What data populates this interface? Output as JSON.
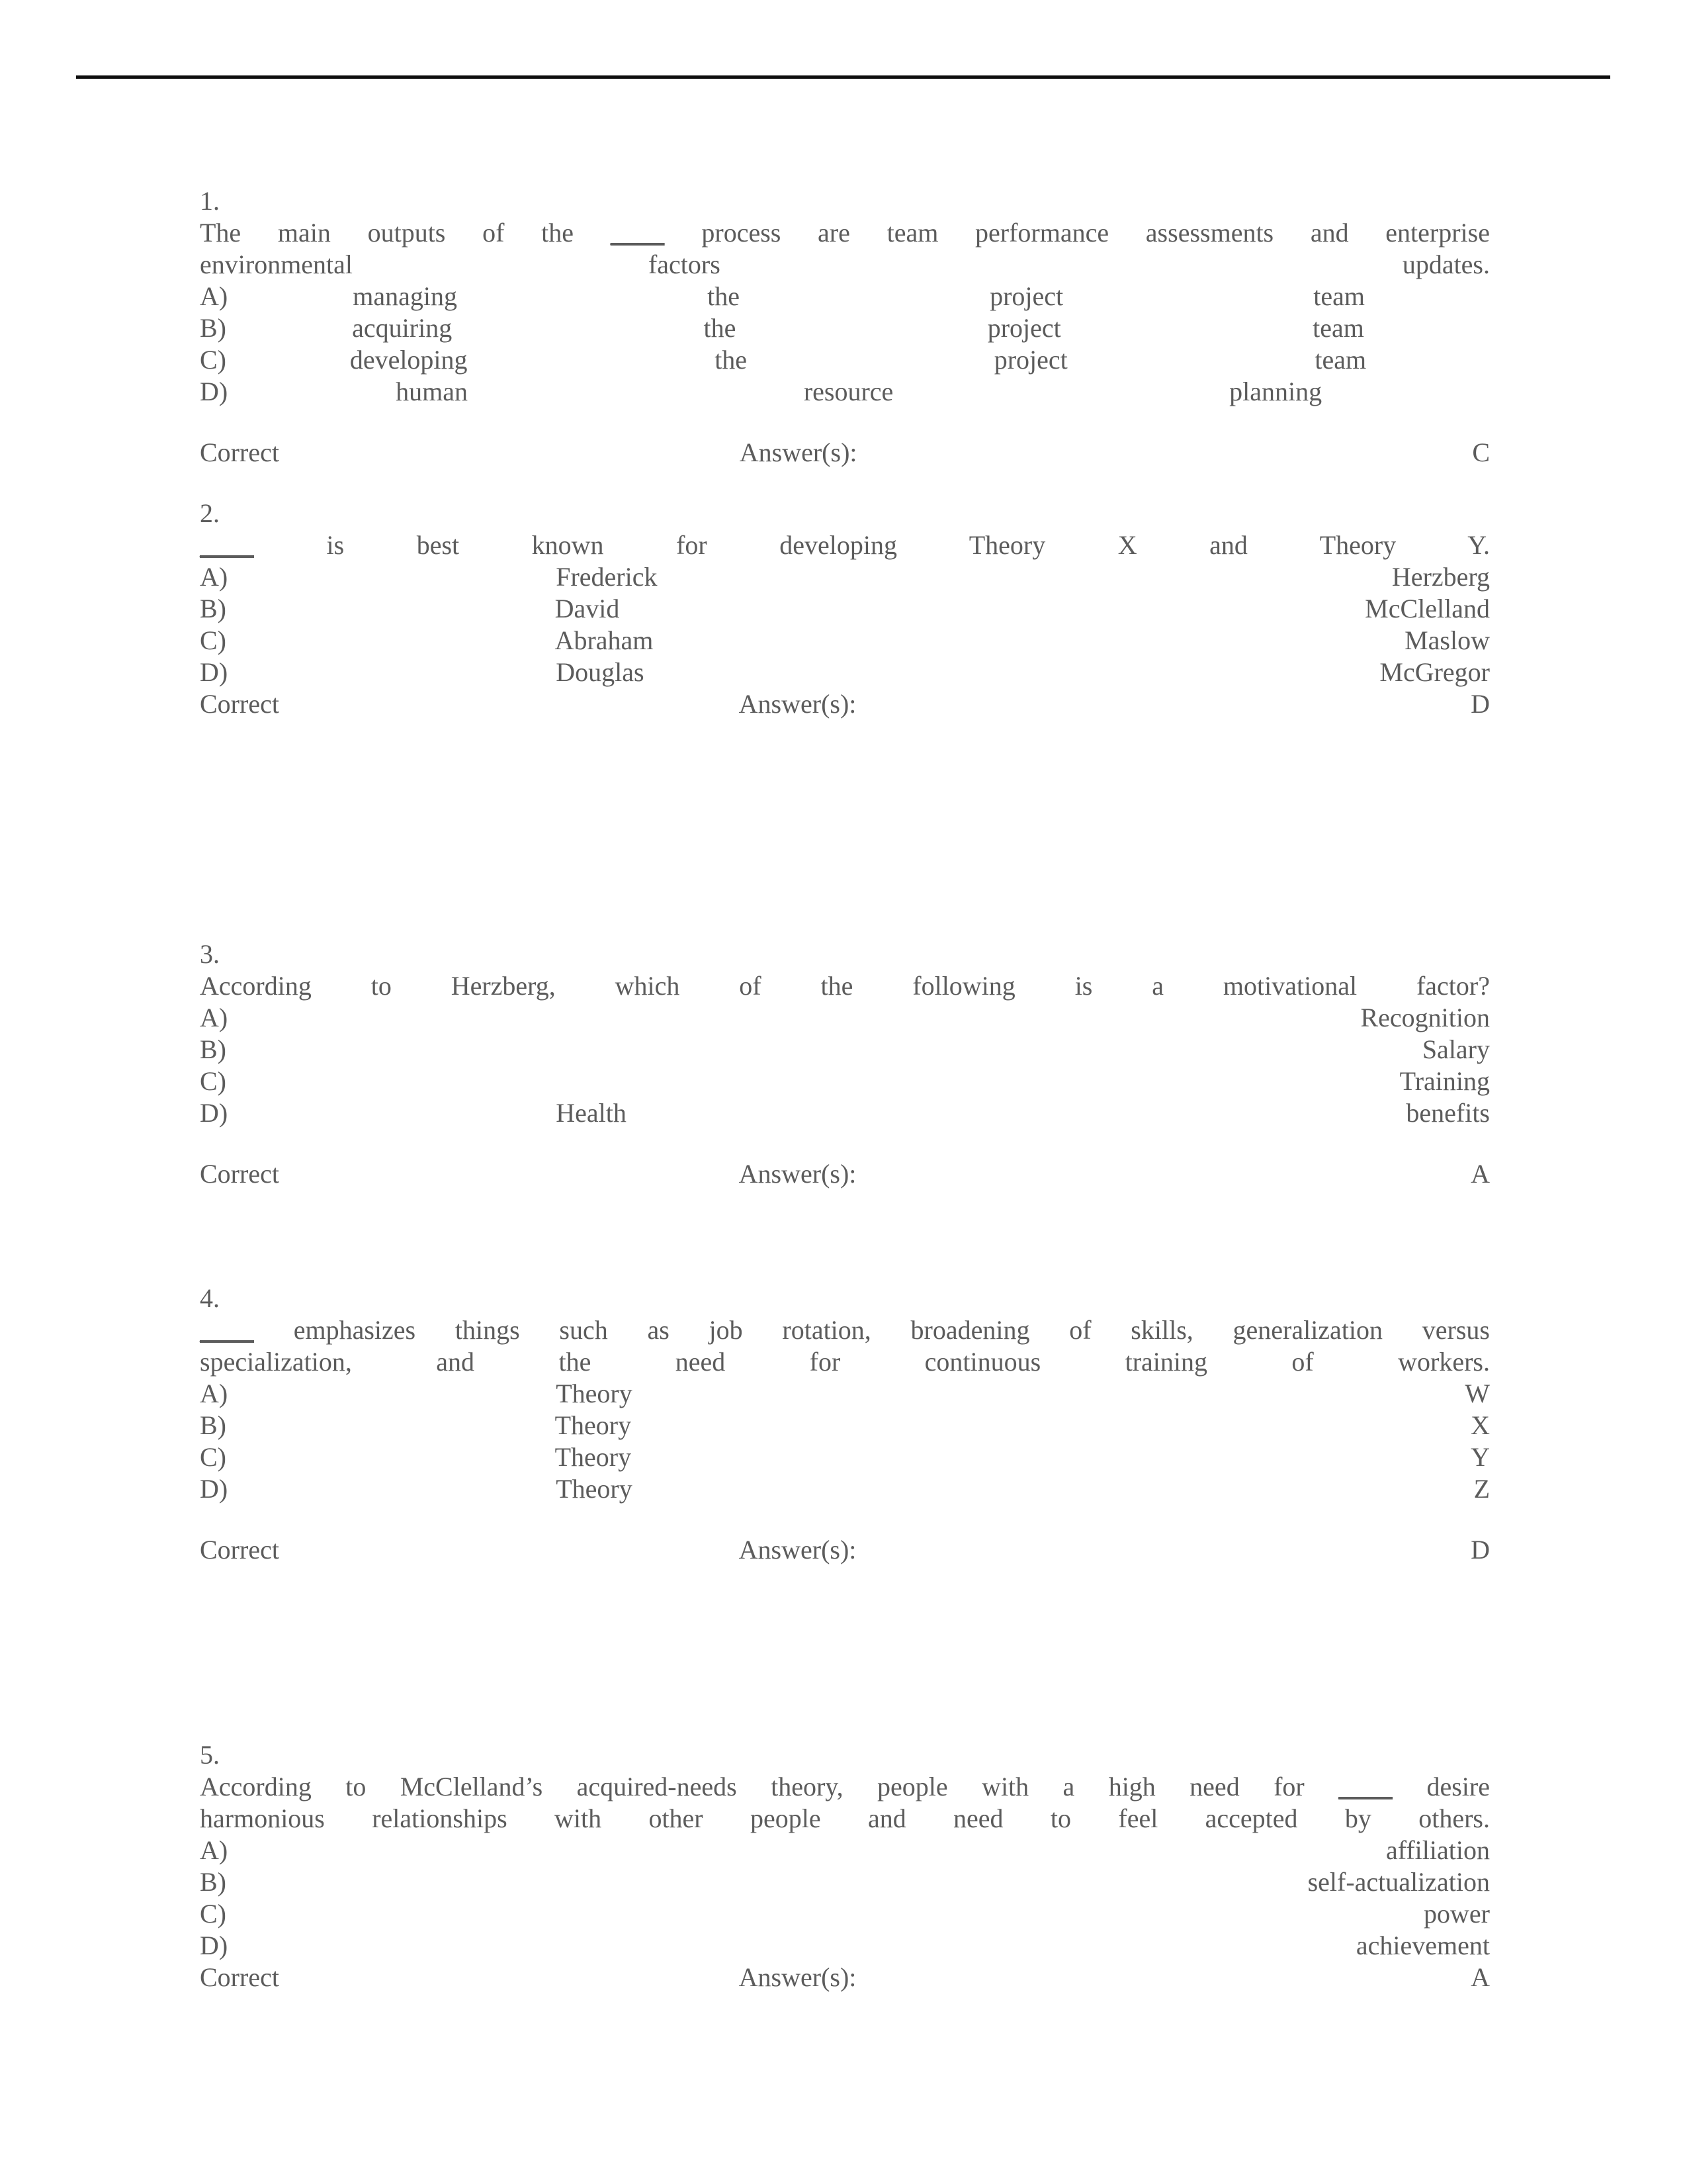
{
  "document": {
    "rule_color": "#0d0d0d",
    "text_color": "#5c5c5c",
    "blank_marker": "____"
  },
  "labels": {
    "correct_label": "Correct",
    "answer_label": "Answer(s):",
    "option_a": "A)",
    "option_b": "B)",
    "option_c": "C)",
    "option_d": "D)"
  },
  "questions": [
    {
      "number": "1.",
      "stem_line1_pre": "The main outputs of the ",
      "stem_blank": "____",
      "stem_line1_post": " process are team performance assessments and enterprise",
      "stem_line2_a": "environmental",
      "stem_line2_b": "factors",
      "stem_line2_c": "updates.",
      "options": [
        {
          "letter": "A)",
          "w1": "managing",
          "w2": "the",
          "w3": "project",
          "w4": "team"
        },
        {
          "letter": "B)",
          "w1": "acquiring",
          "w2": "the",
          "w3": "project",
          "w4": "team"
        },
        {
          "letter": "C)",
          "w1": "developing",
          "w2": "the",
          "w3": "project",
          "w4": "team"
        },
        {
          "letter": "D)",
          "w1": "human",
          "w2": "resource",
          "w3": "planning",
          "w4": ""
        }
      ],
      "correct": "C"
    },
    {
      "number": "2.",
      "stem_blank": "____",
      "stem_text": " is best known for developing Theory X and Theory Y.",
      "options": [
        {
          "letter": "A)",
          "first": "Frederick",
          "last": "Herzberg"
        },
        {
          "letter": "B)",
          "first": "David",
          "last": "McClelland"
        },
        {
          "letter": "C)",
          "first": "Abraham",
          "last": "Maslow"
        },
        {
          "letter": "D)",
          "first": "Douglas",
          "last": "McGregor"
        }
      ],
      "correct": "D"
    },
    {
      "number": "3.",
      "stem_text": "According to Herzberg, which of the following is a motivational factor?",
      "options": [
        {
          "letter": "A)",
          "first": "",
          "last": "Recognition"
        },
        {
          "letter": "B)",
          "first": "",
          "last": "Salary"
        },
        {
          "letter": "C)",
          "first": "",
          "last": "Training"
        },
        {
          "letter": "D)",
          "first": "Health",
          "last": "benefits"
        }
      ],
      "correct": "A"
    },
    {
      "number": "4.",
      "stem_blank": "____",
      "stem_line1": " emphasizes things such as job rotation, broadening of skills, generalization versus",
      "stem_line2": "specialization, and the need for continuous training of workers.",
      "options": [
        {
          "letter": "A)",
          "first": "Theory",
          "last": "W"
        },
        {
          "letter": "B)",
          "first": "Theory",
          "last": "X"
        },
        {
          "letter": "C)",
          "first": "Theory",
          "last": "Y"
        },
        {
          "letter": "D)",
          "first": "Theory",
          "last": "Z"
        }
      ],
      "correct": "D"
    },
    {
      "number": "5.",
      "stem_line1_pre": "According to McClelland’s acquired-needs theory, people with a high need for ",
      "stem_blank": "____",
      "stem_line1_post": " desire",
      "stem_line2": "harmonious relationships with other people and need to feel accepted by others.",
      "options": [
        {
          "letter": "A)",
          "first": "",
          "last": "affiliation"
        },
        {
          "letter": "B)",
          "first": "",
          "last": "self-actualization"
        },
        {
          "letter": "C)",
          "first": "",
          "last": "power"
        },
        {
          "letter": "D)",
          "first": "",
          "last": "achievement"
        }
      ],
      "correct": "A"
    }
  ]
}
